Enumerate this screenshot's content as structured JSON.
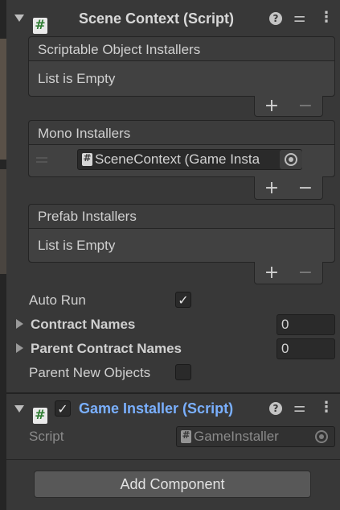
{
  "scene_context": {
    "title": "Scene Context (Script)",
    "lists": [
      {
        "label": "Scriptable Object Installers",
        "empty_text": "List is Empty"
      },
      {
        "label": "Mono Installers",
        "item": "SceneContext (Game Insta"
      },
      {
        "label": "Prefab Installers",
        "empty_text": "List is Empty"
      }
    ],
    "add_label": "+",
    "remove_label": "−",
    "auto_run_label": "Auto Run",
    "auto_run_checked": "✓",
    "contract_names_label": "Contract Names",
    "contract_names_value": "0",
    "parent_contract_names_label": "Parent Contract Names",
    "parent_contract_names_value": "0",
    "parent_new_objects_label": "Parent New Objects"
  },
  "game_installer": {
    "title": "Game Installer (Script)",
    "enabled_checkmark": "✓",
    "script_label": "Script",
    "script_value": "GameInstaller"
  },
  "toolbar_icons": {
    "help": "?",
    "presets": "⚌",
    "menu": "⋮"
  },
  "add_component_label": "Add Component"
}
